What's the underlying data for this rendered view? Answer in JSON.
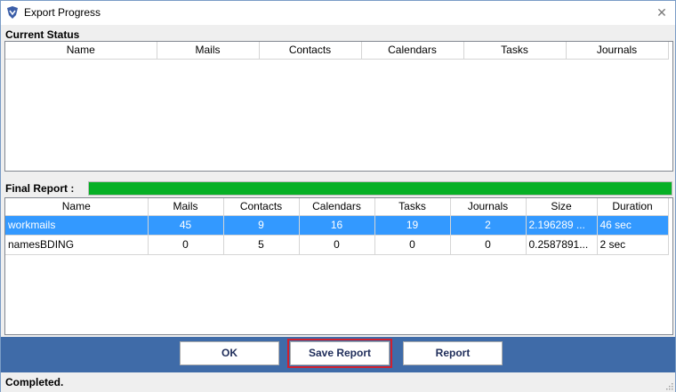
{
  "window": {
    "title": "Export Progress",
    "close_glyph": "✕"
  },
  "current_status": {
    "label": "Current Status",
    "columns": [
      "Name",
      "Mails",
      "Contacts",
      "Calendars",
      "Tasks",
      "Journals"
    ]
  },
  "final_report": {
    "label": "Final Report :",
    "progress": 1.0,
    "progress_color": "#06b025",
    "columns": [
      "Name",
      "Mails",
      "Contacts",
      "Calendars",
      "Tasks",
      "Journals",
      "Size",
      "Duration"
    ],
    "rows": [
      {
        "name": "workmails",
        "mails": "45",
        "contacts": "9",
        "calendars": "16",
        "tasks": "19",
        "journals": "2",
        "size": "2.196289 ...",
        "duration": "46 sec",
        "selected": true
      },
      {
        "name": "namesBDING",
        "mails": "0",
        "contacts": "5",
        "calendars": "0",
        "tasks": "0",
        "journals": "0",
        "size": "0.2587891...",
        "duration": "2 sec",
        "selected": false
      }
    ]
  },
  "buttons": {
    "ok": "OK",
    "save_report": "Save Report",
    "report": "Report"
  },
  "status": {
    "text": "Completed."
  },
  "colors": {
    "selection": "#3399ff",
    "button_bar": "#3f6ba8",
    "focus_outline": "#d0202e"
  }
}
